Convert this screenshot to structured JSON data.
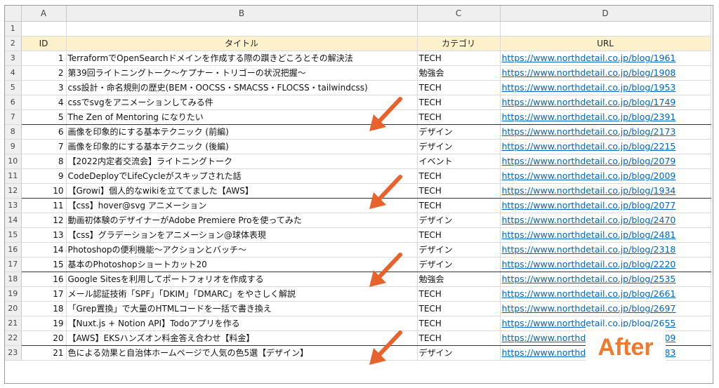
{
  "columns": [
    "A",
    "B",
    "C",
    "D"
  ],
  "header_row": {
    "id": "ID",
    "title": "タイトル",
    "category": "カテゴリ",
    "url": "URL"
  },
  "rows": [
    {
      "id": "1",
      "title": "TerraformでOpenSearchドメインを作成する際の躓きどころとその解決法",
      "category": "TECH",
      "url": "https://www.northdetail.co.jp/blog/1961"
    },
    {
      "id": "2",
      "title": "第39回ライトニングトーク〜ケプナー・トリゴーの状況把握〜",
      "category": "勉強会",
      "url": "https://www.northdetail.co.jp/blog/1908"
    },
    {
      "id": "3",
      "title": "css設計・命名規則の歴史(BEM・OOCSS・SMACSS・FLOCSS・tailwindcss)",
      "category": "TECH",
      "url": "https://www.northdetail.co.jp/blog/1953"
    },
    {
      "id": "4",
      "title": "cssでsvgをアニメーションしてみる件",
      "category": "TECH",
      "url": "https://www.northdetail.co.jp/blog/1749"
    },
    {
      "id": "5",
      "title": "The Zen of Mentoring になりたい",
      "category": "TECH",
      "url": "https://www.northdetail.co.jp/blog/2391"
    },
    {
      "id": "6",
      "title": "画像を印象的にする基本テクニック (前編)",
      "category": "デザイン",
      "url": "https://www.northdetail.co.jp/blog/2173"
    },
    {
      "id": "7",
      "title": "画像を印象的にする基本テクニック (後編)",
      "category": "デザイン",
      "url": "https://www.northdetail.co.jp/blog/2215"
    },
    {
      "id": "8",
      "title": "【2022内定者交流会】ライトニングトーク",
      "category": "イベント",
      "url": "https://www.northdetail.co.jp/blog/2079"
    },
    {
      "id": "9",
      "title": "CodeDeployでLifeCycleがスキップされた話",
      "category": "TECH",
      "url": "https://www.northdetail.co.jp/blog/2009"
    },
    {
      "id": "10",
      "title": "【Growi】個人的なwikiを立ててました【AWS】",
      "category": "TECH",
      "url": "https://www.northdetail.co.jp/blog/1934"
    },
    {
      "id": "11",
      "title": "【css】hover@svg アニメーション",
      "category": "TECH",
      "url": "https://www.northdetail.co.jp/blog/2077"
    },
    {
      "id": "12",
      "title": "動画初体験のデザイナーがAdobe Premiere Proを使ってみた",
      "category": "デザイン",
      "url": "https://www.northdetail.co.jp/blog/2470"
    },
    {
      "id": "13",
      "title": "【css】グラデーションをアニメーション@球体表現",
      "category": "TECH",
      "url": "https://www.northdetail.co.jp/blog/2481"
    },
    {
      "id": "14",
      "title": "Photoshopの便利機能〜アクションとバッチ〜",
      "category": "デザイン",
      "url": "https://www.northdetail.co.jp/blog/2318"
    },
    {
      "id": "15",
      "title": "基本のPhotoshopショートカット20",
      "category": "デザイン",
      "url": "https://www.northdetail.co.jp/blog/2220"
    },
    {
      "id": "16",
      "title": "Google Sitesを利用してポートフォリオを作成する",
      "category": "勉強会",
      "url": "https://www.northdetail.co.jp/blog/2535"
    },
    {
      "id": "17",
      "title": "メール認証技術「SPF」「DKIM」「DMARC」をやさしく解説",
      "category": "TECH",
      "url": "https://www.northdetail.co.jp/blog/2661"
    },
    {
      "id": "18",
      "title": "「Grep置換」で大量のHTMLコードを一括で書き換え",
      "category": "TECH",
      "url": "https://www.northdetail.co.jp/blog/2697"
    },
    {
      "id": "19",
      "title": "【Nuxt.js + Notion API】Todoアプリを作る",
      "category": "TECH",
      "url": "https://www.northdetail.co.jp/blog/2655"
    },
    {
      "id": "20",
      "title": "【AWS】EKSハンズオン料金答え合わせ【料金】",
      "category": "TECH",
      "url": "https://www.northdetail.co.jp/blog/2709"
    },
    {
      "id": "21",
      "title": "色による効果と自治体ホームページで人気の色5選【デザイン】",
      "category": "デザイン",
      "url": "https://www.northdetail.co.jp/blog/1683"
    }
  ],
  "badge": {
    "text": "After",
    "color": "#ef7a2e"
  },
  "colors": {
    "header_fill": "#fdf1cc",
    "link": "#0563c1",
    "arrow": "#e8632c"
  },
  "icons": {
    "arrow": "arrow-down-left-icon"
  }
}
